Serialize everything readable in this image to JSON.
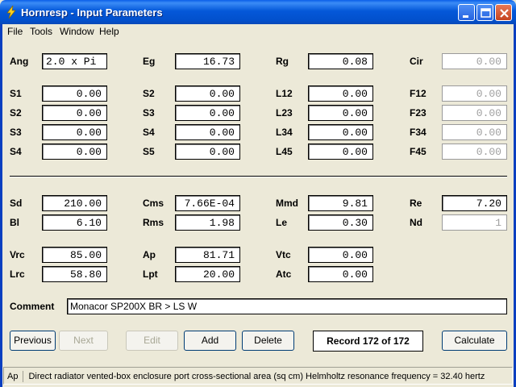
{
  "window": {
    "title": "Hornresp - Input Parameters"
  },
  "menu": [
    {
      "label": "File"
    },
    {
      "label": "Tools"
    },
    {
      "label": "Window"
    },
    {
      "label": "Help"
    }
  ],
  "params": {
    "Ang": {
      "label": "Ang",
      "value": "2.0 x Pi"
    },
    "Eg": {
      "label": "Eg",
      "value": "16.73"
    },
    "Rg": {
      "label": "Rg",
      "value": "0.08"
    },
    "Cir": {
      "label": "Cir",
      "value": "0.00"
    },
    "S1a": {
      "label": "S1",
      "value": "0.00"
    },
    "S2a": {
      "label": "S2",
      "value": "0.00"
    },
    "S3a": {
      "label": "S3",
      "value": "0.00"
    },
    "S4a": {
      "label": "S4",
      "value": "0.00"
    },
    "S2b": {
      "label": "S2",
      "value": "0.00"
    },
    "S3b": {
      "label": "S3",
      "value": "0.00"
    },
    "S4b": {
      "label": "S4",
      "value": "0.00"
    },
    "S5": {
      "label": "S5",
      "value": "0.00"
    },
    "L12": {
      "label": "L12",
      "value": "0.00"
    },
    "L23": {
      "label": "L23",
      "value": "0.00"
    },
    "L34": {
      "label": "L34",
      "value": "0.00"
    },
    "L45": {
      "label": "L45",
      "value": "0.00"
    },
    "F12": {
      "label": "F12",
      "value": "0.00"
    },
    "F23": {
      "label": "F23",
      "value": "0.00"
    },
    "F34": {
      "label": "F34",
      "value": "0.00"
    },
    "F45": {
      "label": "F45",
      "value": "0.00"
    },
    "Sd": {
      "label": "Sd",
      "value": "210.00"
    },
    "Bl": {
      "label": "Bl",
      "value": "6.10"
    },
    "Cms": {
      "label": "Cms",
      "value": "7.66E-04"
    },
    "Rms": {
      "label": "Rms",
      "value": "1.98"
    },
    "Mmd": {
      "label": "Mmd",
      "value": "9.81"
    },
    "Le": {
      "label": "Le",
      "value": "0.30"
    },
    "Re": {
      "label": "Re",
      "value": "7.20"
    },
    "Nd": {
      "label": "Nd",
      "value": "1"
    },
    "Vrc": {
      "label": "Vrc",
      "value": "85.00"
    },
    "Lrc": {
      "label": "Lrc",
      "value": "58.80"
    },
    "Ap": {
      "label": "Ap",
      "value": "81.71"
    },
    "Lpt": {
      "label": "Lpt",
      "value": "20.00"
    },
    "Vtc": {
      "label": "Vtc",
      "value": "0.00"
    },
    "Atc": {
      "label": "Atc",
      "value": "0.00"
    }
  },
  "comment": {
    "label": "Comment",
    "value": "Monacor SP200X BR > LS W"
  },
  "buttons": {
    "previous": "Previous",
    "next": "Next",
    "edit": "Edit",
    "add": "Add",
    "delete": "Delete",
    "calculate": "Calculate"
  },
  "record": "Record 172 of 172",
  "status": {
    "field": "Ap",
    "description": "Direct radiator vented-box enclosure port cross-sectional area  (sq cm)  Helmholtz resonance frequency = 32.40 hertz"
  },
  "icons": {
    "app": "lightning-icon",
    "minimize": "minimize-icon",
    "maximize": "maximize-icon",
    "close": "close-icon"
  }
}
